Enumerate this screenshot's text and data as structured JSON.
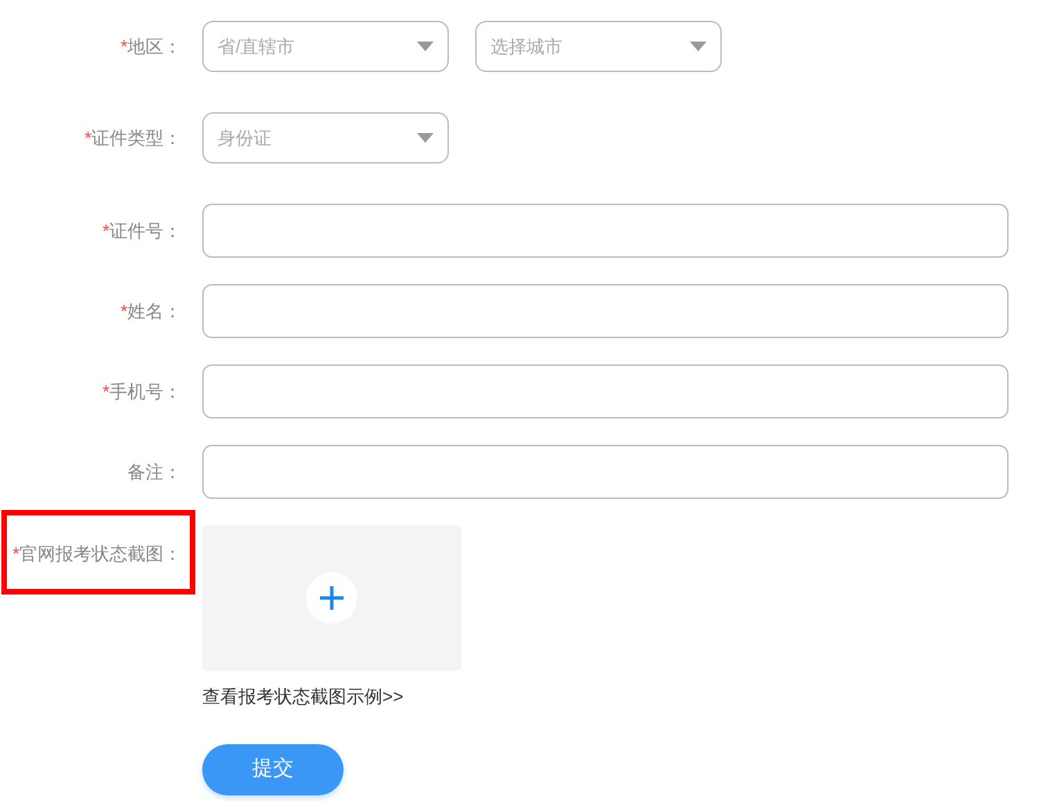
{
  "fields": [
    {
      "kind": "select",
      "mark": "*",
      "label": "地区：",
      "selects": [
        {
          "placeholder": "省/直辖市"
        },
        {
          "placeholder": "选择城市"
        }
      ]
    },
    {
      "kind": "select",
      "mark": "*",
      "label": "证件类型：",
      "selects": [
        {
          "placeholder": "身份证"
        }
      ]
    },
    {
      "kind": "input",
      "mark": "*",
      "label": "证件号："
    },
    {
      "kind": "input",
      "mark": "*",
      "label": "姓名："
    },
    {
      "kind": "input",
      "mark": "*",
      "label": "手机号："
    },
    {
      "kind": "input",
      "label": "备注："
    },
    {
      "kind": "upload",
      "mark": "*",
      "label": "官网报考状态截图：",
      "highlighted": true,
      "link": "查看报考状态截图示例>>"
    }
  ],
  "submit": "提交"
}
